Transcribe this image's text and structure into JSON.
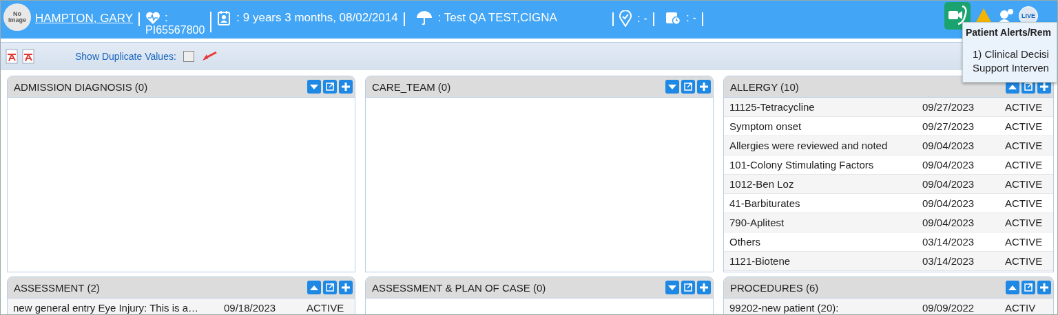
{
  "patient": {
    "name": "HAMPTON, GARY",
    "id_label": ":",
    "id": "PI65567800",
    "age": ": 9 years 3 months, 08/02/2014",
    "insurance": ": Test QA TEST,CIGNA",
    "location": ": -",
    "appointment": ": -",
    "avatar": "No Image",
    "live": "LIVE"
  },
  "toolbar": {
    "duplicate_label": "Show Duplicate Values:",
    "duplicate_checked": false
  },
  "alert_popup": {
    "title": "Patient Alerts/Rem",
    "lines": [
      "1) Clinical Decisi",
      "Support Interven"
    ]
  },
  "panels": [
    {
      "title": "ADMISSION DIAGNOSIS (0)",
      "expanded": false
    },
    {
      "title": "CARE_TEAM (0)",
      "expanded": false
    },
    {
      "title": "ALLERGY (10)",
      "expanded": true,
      "rows": [
        [
          "11125-Tetracycline",
          "09/27/2023",
          "ACTIVE"
        ],
        [
          "Symptom onset",
          "09/27/2023",
          "ACTIVE"
        ],
        [
          "Allergies were reviewed and noted",
          "09/04/2023",
          "ACTIVE"
        ],
        [
          "101-Colony Stimulating Factors",
          "09/04/2023",
          "ACTIVE"
        ],
        [
          "1012-Ben Loz",
          "09/04/2023",
          "ACTIVE"
        ],
        [
          "41-Barbiturates",
          "09/04/2023",
          "ACTIVE"
        ],
        [
          "790-Aplitest",
          "09/04/2023",
          "ACTIVE"
        ],
        [
          "Others",
          "03/14/2023",
          "ACTIVE"
        ],
        [
          "1121-Biotene",
          "03/14/2023",
          "ACTIVE"
        ]
      ]
    },
    {
      "title": "ASSESSMENT (2)",
      "expanded": true,
      "rows": [
        [
          "new general entry Eye Injury: This is a…",
          "09/18/2023",
          "ACTIVE"
        ]
      ]
    },
    {
      "title": "ASSESSMENT & PLAN OF CASE (0)",
      "expanded": false
    },
    {
      "title": "PROCEDURES (6)",
      "expanded": true,
      "rows": [
        [
          "99202-new patient (20):",
          "09/09/2022",
          "ACTIV"
        ]
      ]
    }
  ]
}
